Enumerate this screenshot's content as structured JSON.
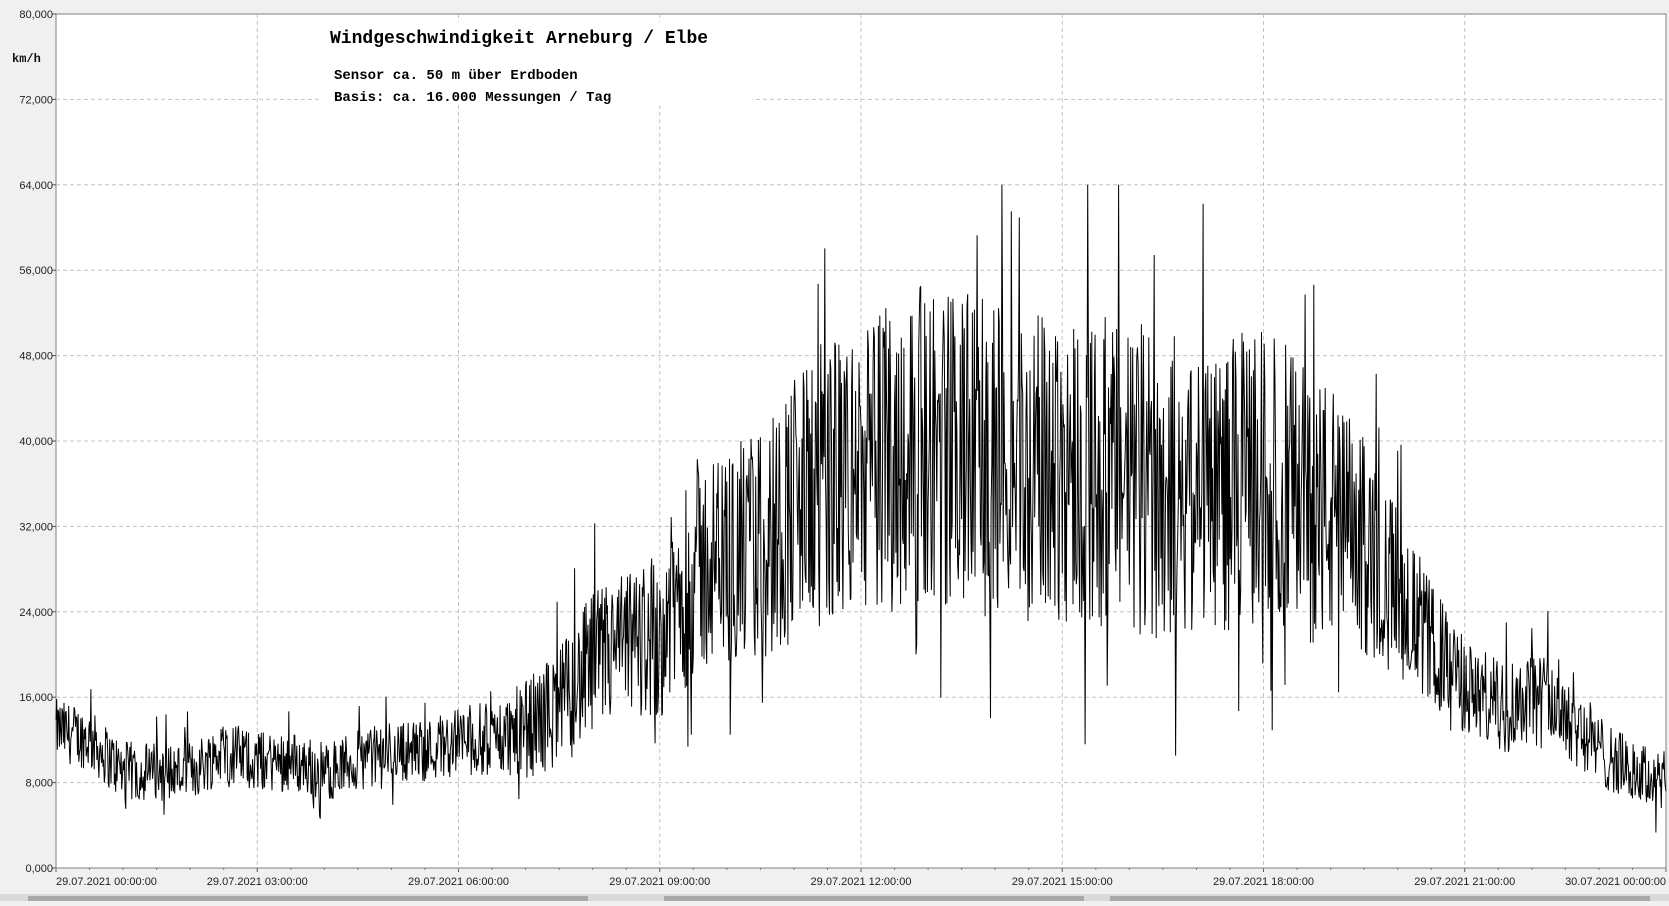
{
  "chart_data": {
    "type": "line",
    "title": "Windgeschwindigkeit  Arneburg / Elbe",
    "subtitle_lines": [
      "Sensor ca. 50 m über Erdboden",
      "Basis: ca. 16.000 Messungen / Tag"
    ],
    "ylabel": "km/h",
    "xlabel": "",
    "ylim": [
      0,
      80
    ],
    "xlim_hours": [
      0,
      24
    ],
    "grid": true,
    "y_ticks": [
      {
        "value": 0,
        "label": "0,000"
      },
      {
        "value": 8,
        "label": "8,000"
      },
      {
        "value": 16,
        "label": "16,000"
      },
      {
        "value": 24,
        "label": "24,000"
      },
      {
        "value": 32,
        "label": "32,000"
      },
      {
        "value": 40,
        "label": "40,000"
      },
      {
        "value": 48,
        "label": "48,000"
      },
      {
        "value": 56,
        "label": "56,000"
      },
      {
        "value": 64,
        "label": "64,000"
      },
      {
        "value": 72,
        "label": "72,000"
      },
      {
        "value": 80,
        "label": "80,000"
      }
    ],
    "x_ticks": [
      {
        "hour": 0,
        "date": "29.07.2021",
        "time": "00:00:00"
      },
      {
        "hour": 3,
        "date": "29.07.2021",
        "time": "03:00:00"
      },
      {
        "hour": 6,
        "date": "29.07.2021",
        "time": "06:00:00"
      },
      {
        "hour": 9,
        "date": "29.07.2021",
        "time": "09:00:00"
      },
      {
        "hour": 12,
        "date": "29.07.2021",
        "time": "12:00:00"
      },
      {
        "hour": 15,
        "date": "29.07.2021",
        "time": "15:00:00"
      },
      {
        "hour": 18,
        "date": "29.07.2021",
        "time": "18:00:00"
      },
      {
        "hour": 21,
        "date": "29.07.2021",
        "time": "21:00:00"
      },
      {
        "hour": 24,
        "date": "30.07.2021",
        "time": "00:00:00"
      }
    ],
    "series": [
      {
        "x_hours": [
          0,
          0.5,
          1,
          1.5,
          2,
          2.5,
          3,
          3.5,
          4,
          4.5,
          5,
          5.5,
          6,
          6.5,
          7,
          7.5,
          8,
          8.5,
          9,
          9.5,
          10,
          10.5,
          11,
          11.5,
          12,
          12.5,
          13,
          13.5,
          14,
          14.5,
          15,
          15.5,
          16,
          16.5,
          17,
          17.5,
          18,
          18.5,
          19,
          19.5,
          20,
          20.5,
          21,
          21.5,
          22,
          22.5,
          23,
          23.5,
          24
        ],
        "mean": [
          13,
          12,
          9,
          9,
          9,
          11,
          10,
          10,
          9,
          10,
          11,
          11,
          12,
          12,
          13,
          15,
          19,
          21,
          22,
          28,
          29,
          30,
          34,
          36,
          37,
          39,
          40,
          39,
          38,
          37,
          38,
          37,
          36,
          36,
          35,
          36,
          37,
          35,
          33,
          30,
          26,
          21,
          17,
          15,
          16,
          15,
          11,
          9,
          8
        ],
        "spread": [
          2.5,
          2.5,
          2.5,
          2.5,
          2.5,
          2.5,
          2.5,
          2.5,
          2.5,
          2.5,
          2.5,
          2.5,
          3,
          3,
          4,
          5,
          6,
          6,
          7,
          9,
          9,
          10,
          11,
          12,
          12,
          13,
          13,
          13,
          13,
          13,
          13,
          13,
          13,
          13,
          12,
          12,
          12,
          12,
          11,
          9,
          7,
          5,
          4,
          4,
          4,
          4,
          3,
          2.5,
          2.5
        ]
      }
    ]
  }
}
